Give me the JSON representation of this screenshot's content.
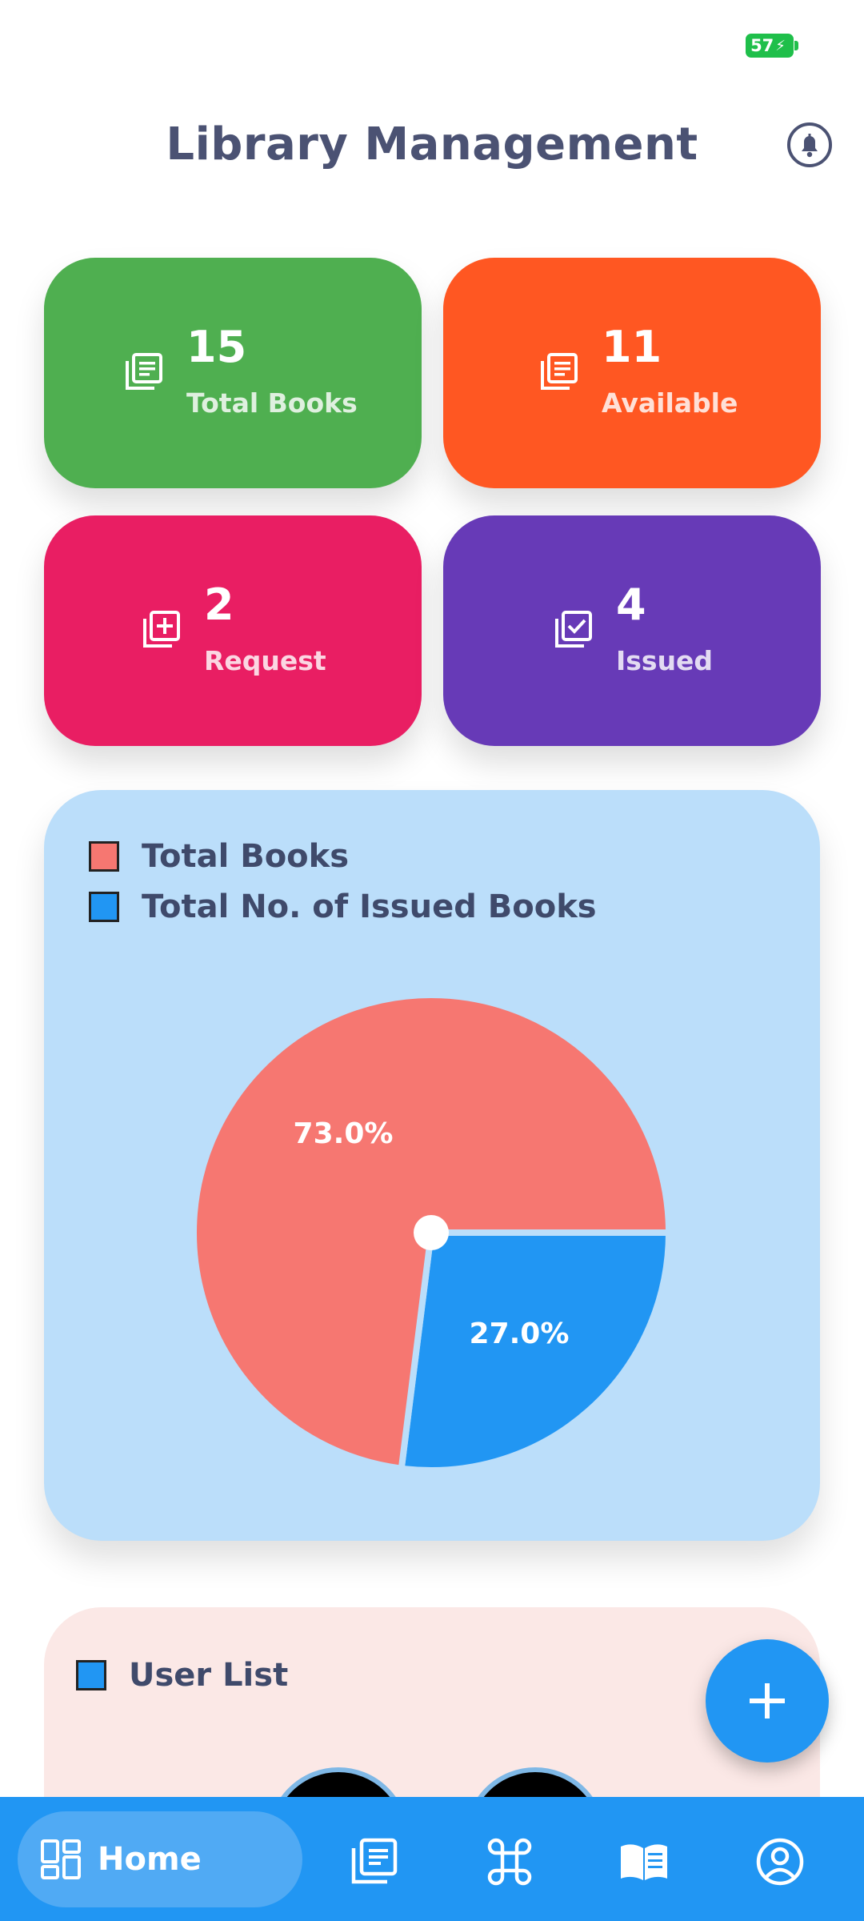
{
  "status": {
    "battery": "57"
  },
  "header": {
    "title": "Library Management"
  },
  "cards": [
    {
      "value": "15",
      "label": "Total Books",
      "color": "#4faf50",
      "icon": "book-list-icon"
    },
    {
      "value": "11",
      "label": "Available",
      "color": "#ff5722",
      "icon": "book-list-icon"
    },
    {
      "value": "2",
      "label": "Request",
      "color": "#e91e63",
      "icon": "library-add-icon"
    },
    {
      "value": "4",
      "label": "Issued",
      "color": "#673ab7",
      "icon": "library-check-icon"
    }
  ],
  "chart_data": {
    "type": "pie",
    "legend": [
      "Total Books",
      "Total No. of Issued Books"
    ],
    "legend_position": "top-left",
    "slices": [
      {
        "name": "Total Books",
        "value": 73.0,
        "label": "73.0%",
        "color": "#f67771"
      },
      {
        "name": "Total No. of Issued Books",
        "value": 27.0,
        "label": "27.0%",
        "color": "#2196f3"
      }
    ]
  },
  "user_section": {
    "title": "User List",
    "legend_color": "#2196f3"
  },
  "fab": {
    "icon": "plus-icon"
  },
  "nav": {
    "home_label": "Home",
    "items": [
      "dashboard-icon",
      "book-list-icon",
      "command-icon",
      "open-book-icon",
      "account-circle-icon"
    ]
  }
}
